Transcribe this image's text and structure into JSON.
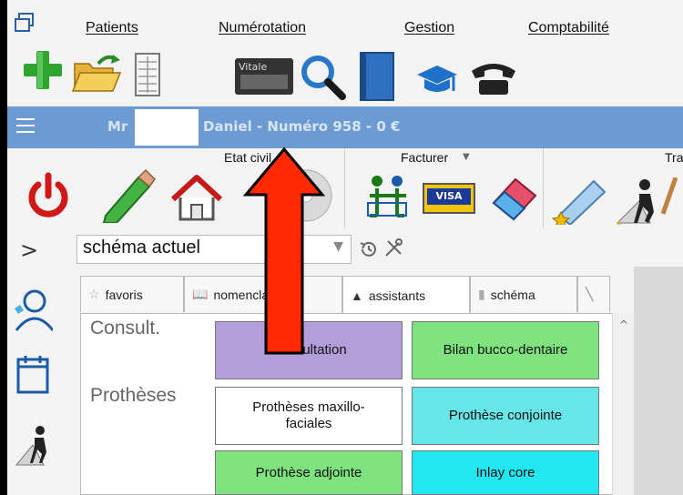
{
  "menubar": {
    "items": [
      {
        "label": "Patients"
      },
      {
        "label": "Numérotation"
      },
      {
        "label": "Gestion"
      },
      {
        "label": "Comptabilité"
      }
    ]
  },
  "toolbar": {
    "icons": [
      "add-patient-icon",
      "open-folder-icon",
      "spreadsheet-icon",
      "vitale-card-icon",
      "search-icon",
      "book-icon",
      "graduation-icon",
      "telephone-icon"
    ],
    "vitale_text": "Vitale"
  },
  "patientbar": {
    "title": "Mr",
    "name_info": "Daniel  - Numéro 958 - 0 €",
    "color": "#6b9bd2"
  },
  "toolbar2": {
    "labels": {
      "etat": "Etat civil",
      "facturer": "Facturer",
      "tra": "Tra"
    },
    "card_text": "VISA"
  },
  "schema": {
    "selected": "schéma actuel"
  },
  "tabs": [
    {
      "label": "favoris"
    },
    {
      "label": "nomenclature"
    },
    {
      "label": "assistants"
    },
    {
      "label": "schéma"
    }
  ],
  "content": {
    "categories": [
      {
        "label": "Consult."
      },
      {
        "label": "Prothèses"
      }
    ],
    "buttons": [
      {
        "label": "Consultation",
        "color": "#b39ddb"
      },
      {
        "label": "Bilan bucco-dentaire",
        "color": "#7ee27e"
      },
      {
        "label": "Prothèses maxillo-faciales",
        "color": "#ffffff"
      },
      {
        "label": "Prothèse conjointe",
        "color": "#66e6e6"
      },
      {
        "label": "Prothèse adjointe",
        "color": "#7ee27e"
      },
      {
        "label": "Inlay core",
        "color": "#22e6f0"
      }
    ]
  },
  "colors": {
    "arrow": "#ff2a00",
    "accent_blue": "#6b9bd2"
  }
}
